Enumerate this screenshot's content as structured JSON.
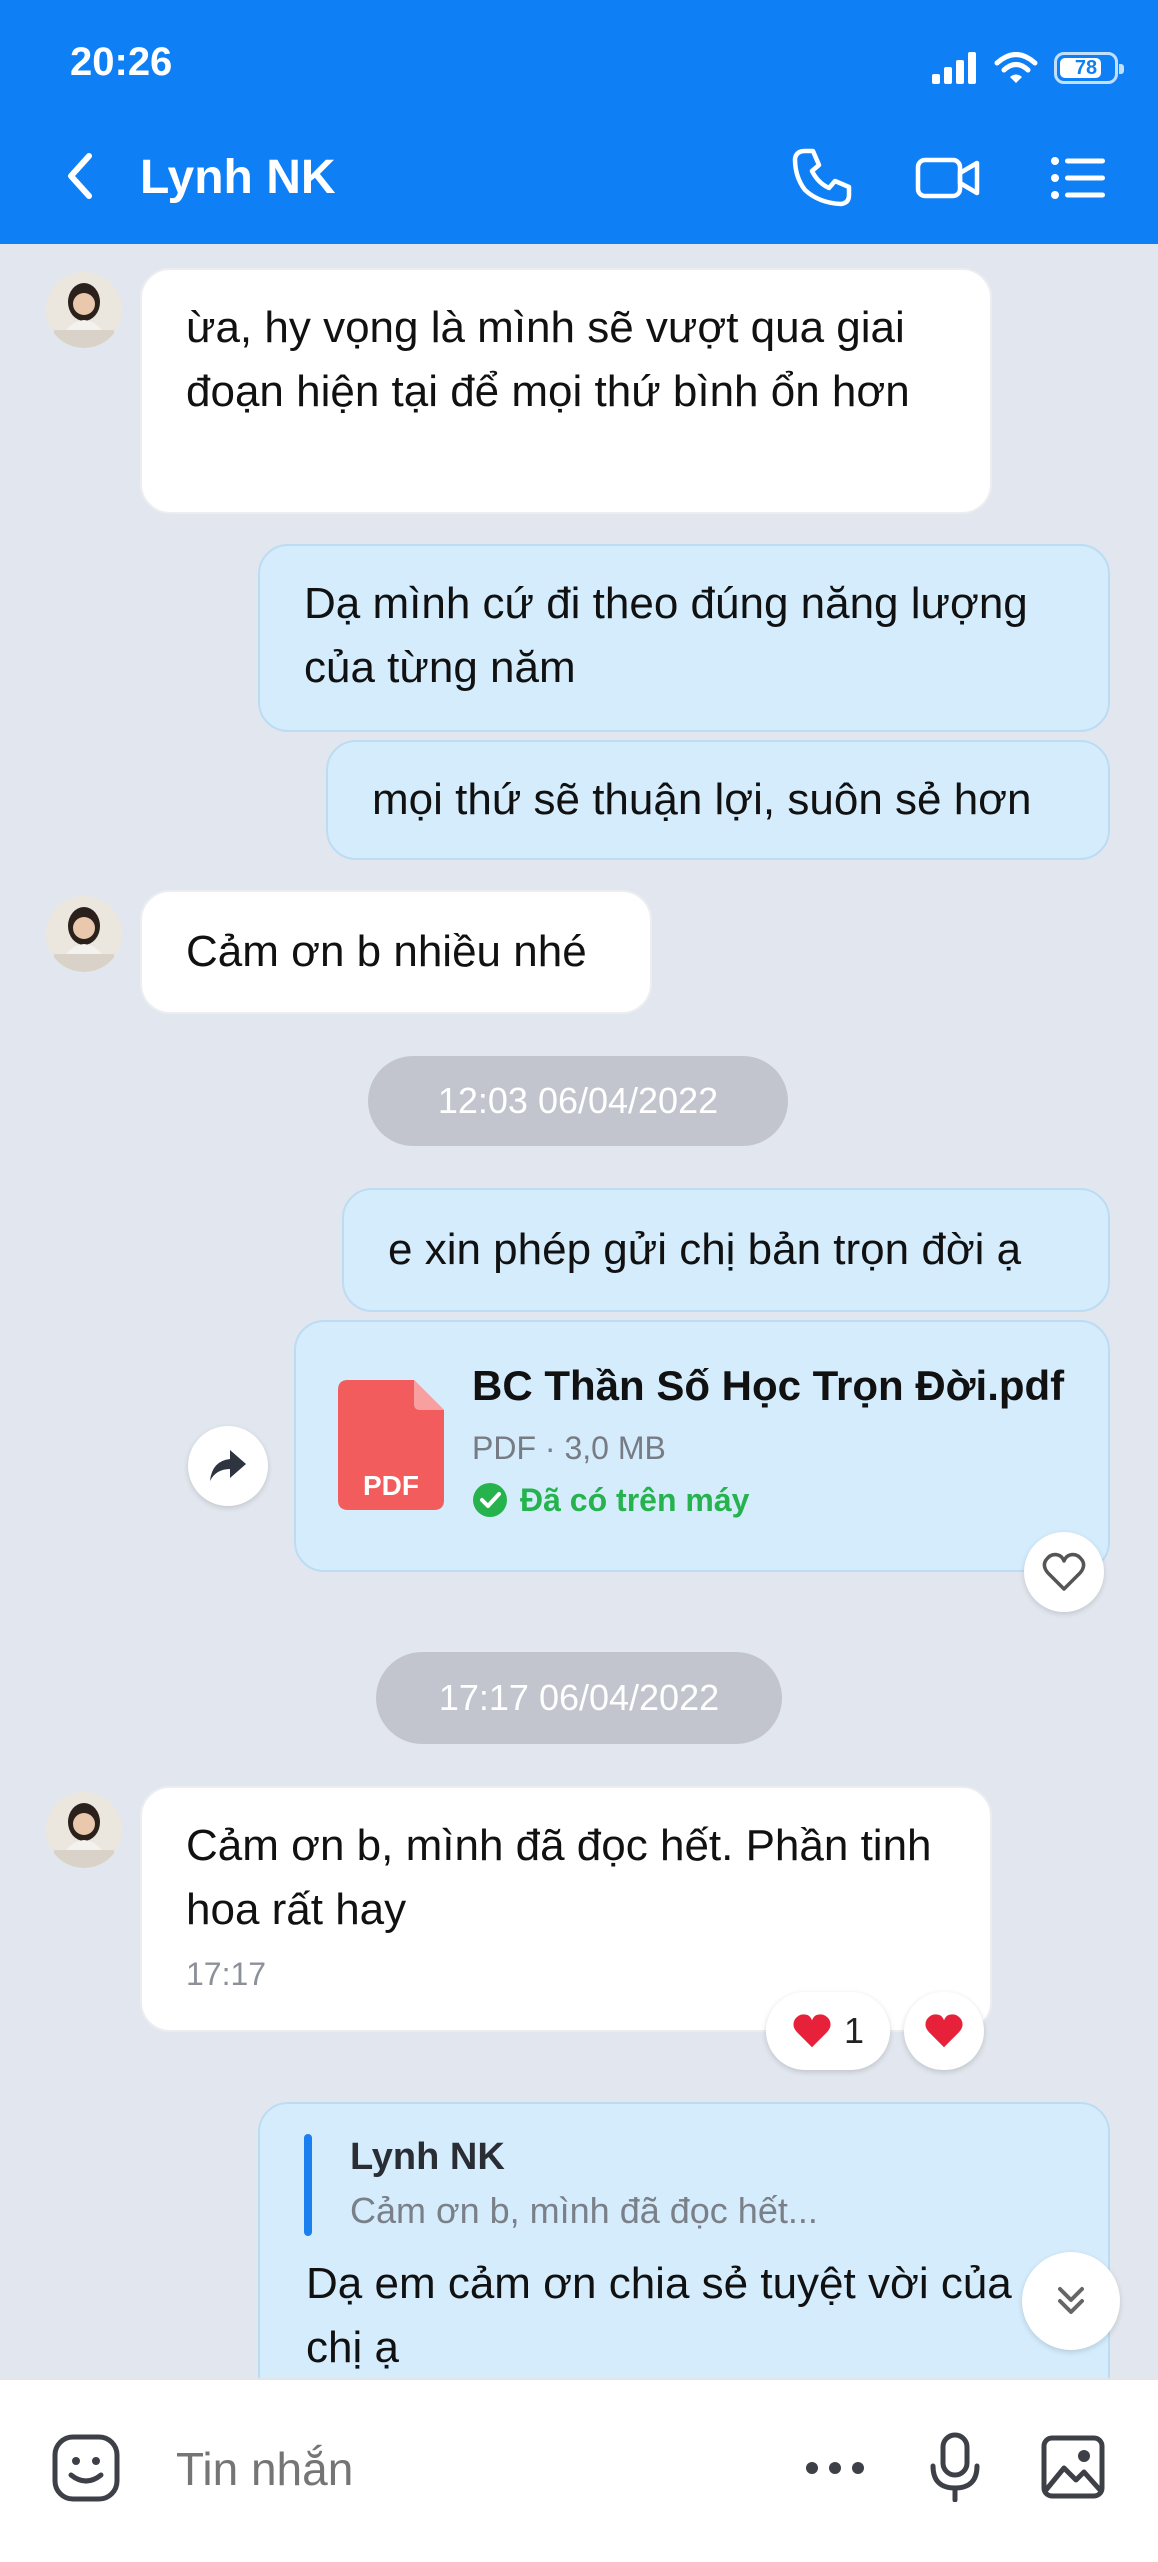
{
  "status_bar": {
    "time": "20:26",
    "battery": "78",
    "battery_level_percent": 78
  },
  "header": {
    "title": "Lynh NK",
    "icons": [
      "back-icon",
      "phone-icon",
      "video-call-icon",
      "menu-list-icon"
    ]
  },
  "messages": [
    {
      "id": "m1",
      "direction": "in",
      "text": "ừa, hy vọng là mình sẽ vượt qua giai đoạn hiện tại để mọi thứ bình ổn hơn"
    },
    {
      "id": "m2",
      "direction": "out",
      "text": "Dạ mình cứ đi theo đúng năng lượng của từng năm"
    },
    {
      "id": "m3",
      "direction": "out",
      "text": "mọi thứ sẽ thuận lợi, suôn sẻ hơn"
    },
    {
      "id": "m4",
      "direction": "in",
      "text": "Cảm ơn b nhiều nhé"
    },
    {
      "id": "t1",
      "type": "timestamp",
      "text": "12:03 06/04/2022"
    },
    {
      "id": "m5",
      "direction": "out",
      "text": "e xin phép gửi chị bản trọn đời ạ"
    },
    {
      "id": "m6",
      "direction": "out",
      "type": "file",
      "file_name": "BC Thần Số Học Trọn Đời.pdf",
      "file_icon_label": "PDF",
      "file_meta": "PDF · 3,0 MB",
      "file_status": "Đã có trên máy"
    },
    {
      "id": "t2",
      "type": "timestamp",
      "text": "17:17 06/04/2022"
    },
    {
      "id": "m7",
      "direction": "in",
      "text": "Cảm ơn b, mình đã đọc hết. Phần tinh hoa rất hay",
      "time": "17:17",
      "reaction_count": "1"
    },
    {
      "id": "m8",
      "direction": "out",
      "quote_author": "Lynh NK",
      "quote_text": "Cảm ơn b, mình đã đọc hết...",
      "text": "Dạ em cảm ơn chia sẻ tuyệt vời của chị ạ"
    }
  ],
  "input_bar": {
    "placeholder": "Tin nhắn",
    "icons": [
      "sticker-icon",
      "more-icon",
      "microphone-icon",
      "image-icon"
    ]
  },
  "colors": {
    "header_blue": "#0f7ff5",
    "chat_background": "#e2e7ef",
    "incoming_bubble": "#ffffff",
    "outgoing_bubble": "#d4ecfc",
    "timestamp_pill": "#c2c5ce",
    "pdf_red": "#f25c5c",
    "status_green": "#26b34e",
    "quote_bar": "#1a80f0",
    "reaction_red": "#e8213a"
  }
}
